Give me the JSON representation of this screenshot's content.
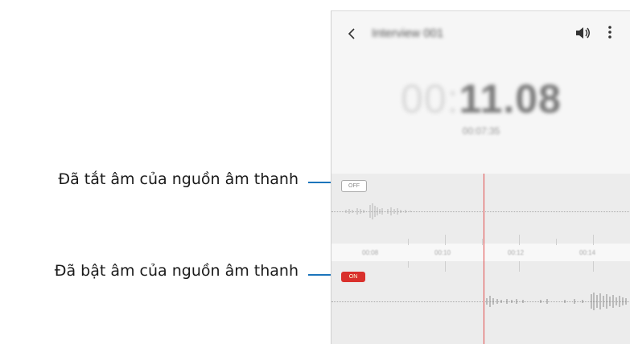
{
  "callouts": {
    "muted_label": "Đã tắt âm của nguồn âm thanh",
    "unmuted_label": "Đã bật âm của nguồn âm thanh",
    "line_color": "#1b75bb"
  },
  "recorder": {
    "title": "Interview 001",
    "timer_dim": "00:",
    "timer_main": "11.08",
    "subtimer": "00:07:35",
    "icons": {
      "back": "back-arrow-icon",
      "volume": "volume-icon",
      "more": "more-options-icon"
    },
    "tracks": {
      "top_badge": "OFF",
      "bottom_badge": "ON",
      "accent_color": "#d9302c"
    },
    "timeline_labels": [
      "00:08",
      "00:10",
      "00:12",
      "00:14"
    ]
  }
}
